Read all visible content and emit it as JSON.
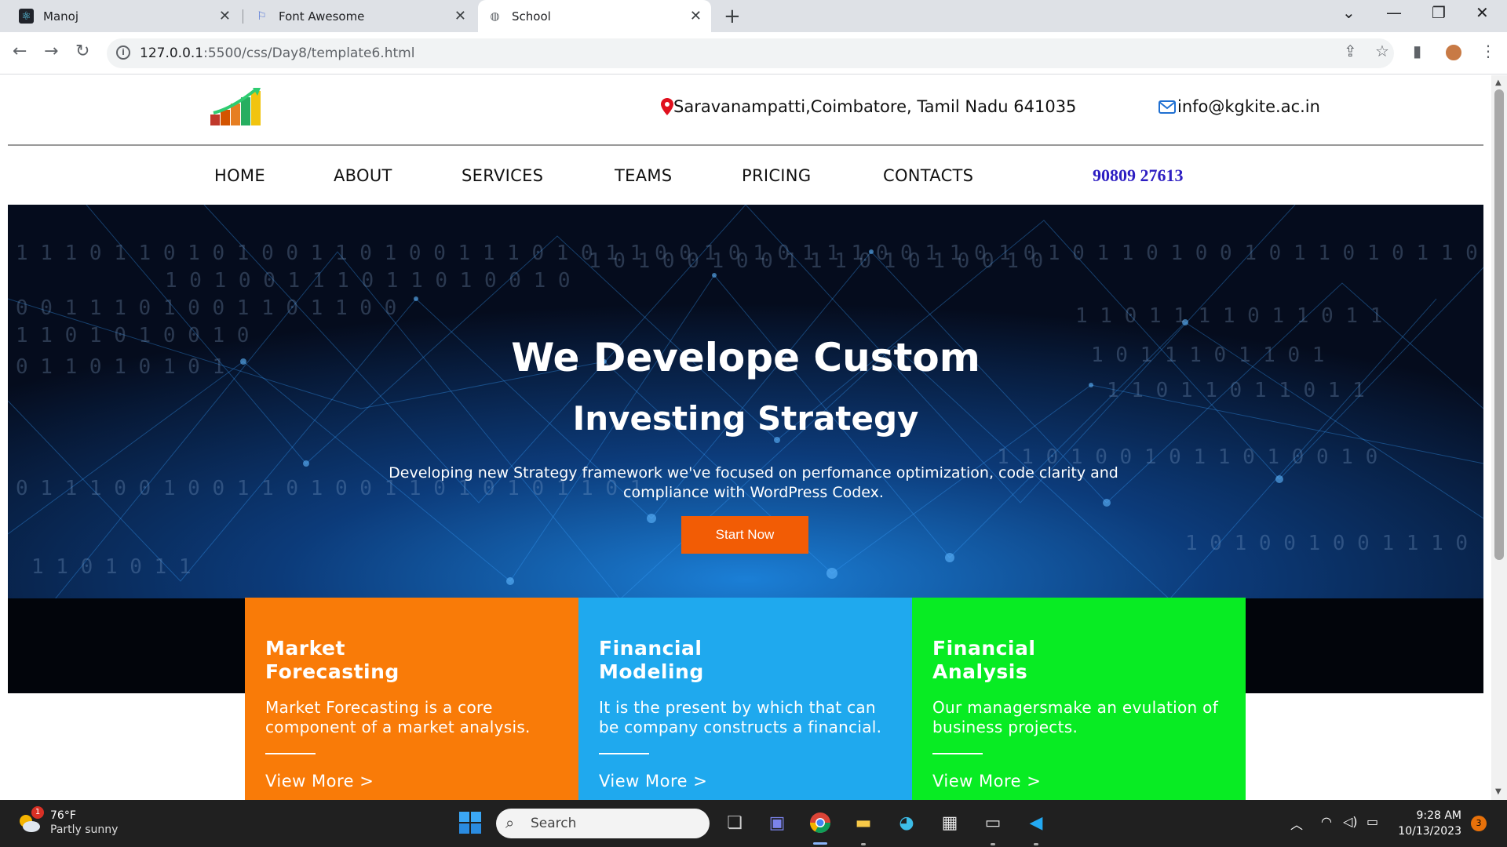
{
  "browser": {
    "tabs": [
      {
        "title": "Manoj",
        "icon": "react-icon"
      },
      {
        "title": "Font Awesome",
        "icon": "flag-icon"
      },
      {
        "title": "School",
        "icon": "globe-icon"
      }
    ],
    "url_host": "127.0.0.1",
    "url_path": ":5500/css/Day8/template6.html"
  },
  "header": {
    "address": "Saravanampatti,Coimbatore, Tamil Nadu 641035",
    "email": "info@kgkite.ac.in"
  },
  "nav": {
    "items": [
      "HOME",
      "ABOUT",
      "SERVICES",
      "TEAMS",
      "PRICING",
      "CONTACTS"
    ],
    "phone": "90809 27613"
  },
  "hero": {
    "title_line1": "We Develope Custom",
    "title_line2": "Investing Strategy",
    "description": "Developing new Strategy framework we've focused on perfomance optimization, code clarity and compliance with WordPress Codex.",
    "cta": "Start Now"
  },
  "cards": [
    {
      "title": "Market Forecasting",
      "text": "Market Forecasting is a core component of a market analysis.",
      "link": "View More >",
      "color": "#f97b08"
    },
    {
      "title": "Financial Modeling",
      "text": "It is the present by which that can be company constructs a financial.",
      "link": "View More >",
      "color": "#1fa9ee"
    },
    {
      "title": "Financial Analysis",
      "text": "Our managersmake an evulation of business projects.",
      "link": "View More >",
      "color": "#08ec23"
    }
  ],
  "taskbar": {
    "weather_temp": "76°F",
    "weather_desc": "Partly sunny",
    "weather_badge": "1",
    "search_label": "Search",
    "time": "9:28 AM",
    "date": "10/13/2023",
    "notifications": "3"
  },
  "colors": {
    "accent_orange": "#f25c05",
    "phone_blue": "#2d1ec2"
  }
}
